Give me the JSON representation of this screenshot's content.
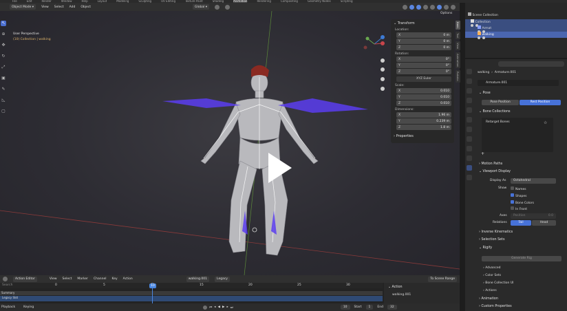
{
  "top_menu": [
    "File",
    "Edit",
    "Render",
    "Window",
    "Help",
    "Layout",
    "Modeling",
    "Sculpting",
    "UV Editing",
    "Texture Paint",
    "Shading",
    "Animation",
    "Rendering",
    "Compositing",
    "Geometry Nodes",
    "Scripting"
  ],
  "viewport_header": {
    "mode": "Object Mode",
    "menus": [
      "View",
      "Select",
      "Add",
      "Object"
    ],
    "transform_orientation": "Global",
    "options": "Options"
  },
  "viewport": {
    "perspective": "User Perspective",
    "collection_info": "(10) Collection | walking"
  },
  "npanel": {
    "title": "Transform",
    "location_label": "Location:",
    "location": [
      {
        "axis": "X",
        "value": "0 m"
      },
      {
        "axis": "Y",
        "value": "0 m"
      },
      {
        "axis": "Z",
        "value": "0 m"
      }
    ],
    "rotation_label": "Rotation:",
    "rotation": [
      {
        "axis": "X",
        "value": "0°"
      },
      {
        "axis": "Y",
        "value": "0°"
      },
      {
        "axis": "Z",
        "value": "0°"
      }
    ],
    "rotation_mode": "XYZ Euler",
    "scale_label": "Scale:",
    "scale": [
      {
        "axis": "X",
        "value": "0.010"
      },
      {
        "axis": "Y",
        "value": "0.010"
      },
      {
        "axis": "Z",
        "value": "0.010"
      }
    ],
    "dimensions_label": "Dimensions:",
    "dimensions": [
      {
        "axis": "X",
        "value": "1.96 m"
      },
      {
        "axis": "Y",
        "value": "0.239 m"
      },
      {
        "axis": "Z",
        "value": "1.8 m"
      }
    ],
    "properties": "Properties",
    "tabs": [
      "Item",
      "Tool",
      "View",
      "Animation",
      "Rokoko"
    ]
  },
  "outliner": {
    "scene": "Scene Collection",
    "rows": [
      {
        "label": "Collection",
        "indent": 0
      },
      {
        "label": "Armat",
        "indent": 1
      },
      {
        "label": "walking",
        "indent": 1
      }
    ]
  },
  "properties": {
    "search_placeholder": "",
    "breadcrumb_object": "walking",
    "breadcrumb_data": "Armature.001",
    "data_name": "Armature.001",
    "pose_section": "Pose",
    "pose_position": "Pose Position",
    "rest_position": "Rest Position",
    "bone_collections": "Bone Collections",
    "retarget_bones": "Retarget Bones",
    "motion_paths": "Motion Paths",
    "viewport_display": "Viewport Display",
    "display_as_label": "Display As",
    "display_as_value": "Octahedral",
    "show_label": "Show",
    "show_options": [
      {
        "label": "Names",
        "checked": false
      },
      {
        "label": "Shapes",
        "checked": true
      },
      {
        "label": "Bone Colors",
        "checked": true
      },
      {
        "label": "In Front",
        "checked": false
      }
    ],
    "axes_label": "Axes",
    "position_label": "Position",
    "position_value": "0.0",
    "relations_label": "Relations",
    "relations_tail": "Tail",
    "relations_head": "Head",
    "sections_after": [
      "Inverse Kinematics",
      "Selection Sets",
      "Rigify"
    ],
    "rigify_button": "Generate Rig",
    "rigify_sub": [
      "Advanced",
      "Color Sets",
      "Bone Collection UI",
      "Actions"
    ],
    "sections_bottom": [
      "Animation",
      "Custom Properties"
    ]
  },
  "timeline": {
    "editor": "Action Editor",
    "menus": [
      "View",
      "Select",
      "Marker",
      "Channel",
      "Key",
      "Action"
    ],
    "action_name": "walking.001",
    "slot": "Legacy",
    "to_scene_range": "To Scene Range",
    "search_placeholder": "Search",
    "current_frame": "10",
    "ruler": [
      "0",
      "5",
      "10",
      "15",
      "20",
      "25",
      "30"
    ],
    "summary": "Summary",
    "legacy_slot": "Legacy Slot",
    "right_panel_title": "Action",
    "right_panel_action": "walking.001",
    "playback": "Playback",
    "keying": "Keying",
    "frame_field": "10",
    "start_label": "Start",
    "start_value": "1",
    "end_label": "End",
    "end_value": "32"
  }
}
